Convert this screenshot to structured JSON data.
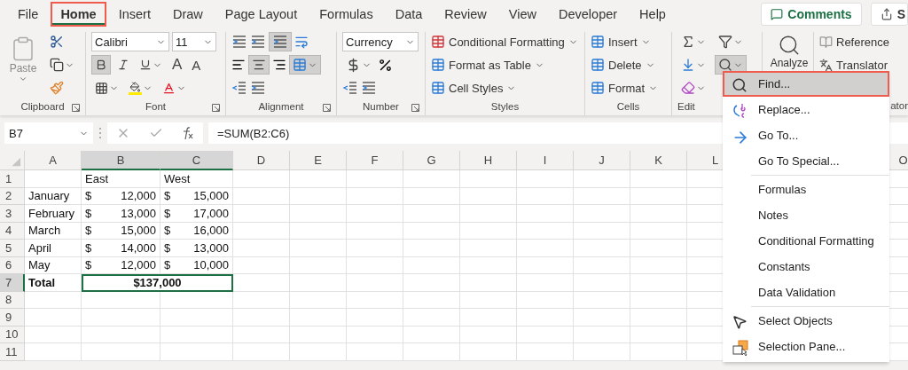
{
  "tabs": [
    {
      "label": "File",
      "selected": false
    },
    {
      "label": "Home",
      "selected": true
    },
    {
      "label": "Insert",
      "selected": false
    },
    {
      "label": "Draw",
      "selected": false
    },
    {
      "label": "Page Layout",
      "selected": false
    },
    {
      "label": "Formulas",
      "selected": false
    },
    {
      "label": "Data",
      "selected": false
    },
    {
      "label": "Review",
      "selected": false
    },
    {
      "label": "View",
      "selected": false
    },
    {
      "label": "Developer",
      "selected": false
    },
    {
      "label": "Help",
      "selected": false
    }
  ],
  "comments_button": "Comments",
  "share_button": "S",
  "ribbon": {
    "clipboard": {
      "paste": "Paste",
      "label": "Clipboard"
    },
    "font": {
      "name": "Calibri",
      "size": "11",
      "grow": "A",
      "shrink": "A",
      "label": "Font"
    },
    "alignment": {
      "label": "Alignment"
    },
    "number": {
      "format": "Currency",
      "label": "Number"
    },
    "styles": {
      "items": [
        "Conditional Formatting",
        "Format as Table",
        "Cell Styles"
      ],
      "label": "Styles"
    },
    "cells": {
      "items": [
        "Insert",
        "Delete",
        "Format"
      ],
      "label": "Cells"
    },
    "editing": {
      "label": "Edit"
    },
    "analyze": {
      "label": "Analyze"
    },
    "language": {
      "items": [
        "Reference",
        "Translator"
      ],
      "label": "ator"
    }
  },
  "formula_bar": {
    "name_box": "B7",
    "formula": "=SUM(B2:C6)"
  },
  "sheet": {
    "columns": [
      {
        "label": "A",
        "selected": false
      },
      {
        "label": "B",
        "selected": true
      },
      {
        "label": "C",
        "selected": true
      },
      {
        "label": "D",
        "selected": false
      },
      {
        "label": "E",
        "selected": false
      },
      {
        "label": "F",
        "selected": false
      },
      {
        "label": "G",
        "selected": false
      },
      {
        "label": "H",
        "selected": false
      },
      {
        "label": "I",
        "selected": false
      },
      {
        "label": "J",
        "selected": false
      },
      {
        "label": "K",
        "selected": false
      },
      {
        "label": "L",
        "selected": false
      },
      {
        "label": "O",
        "selected": false
      }
    ],
    "rows": [
      {
        "label": "1",
        "selected": false,
        "cells": [
          {
            "kind": "empty"
          },
          {
            "kind": "text",
            "text": "East"
          },
          {
            "kind": "text",
            "text": "West"
          }
        ]
      },
      {
        "label": "2",
        "selected": false,
        "cells": [
          {
            "kind": "text",
            "text": "January"
          },
          {
            "kind": "currency",
            "symbol": "$",
            "amount": "12,000"
          },
          {
            "kind": "currency",
            "symbol": "$",
            "amount": "15,000"
          }
        ]
      },
      {
        "label": "3",
        "selected": false,
        "cells": [
          {
            "kind": "text",
            "text": "February"
          },
          {
            "kind": "currency",
            "symbol": "$",
            "amount": "13,000"
          },
          {
            "kind": "currency",
            "symbol": "$",
            "amount": "17,000"
          }
        ]
      },
      {
        "label": "4",
        "selected": false,
        "cells": [
          {
            "kind": "text",
            "text": "March"
          },
          {
            "kind": "currency",
            "symbol": "$",
            "amount": "15,000"
          },
          {
            "kind": "currency",
            "symbol": "$",
            "amount": "16,000"
          }
        ]
      },
      {
        "label": "5",
        "selected": false,
        "cells": [
          {
            "kind": "text",
            "text": "April"
          },
          {
            "kind": "currency",
            "symbol": "$",
            "amount": "14,000"
          },
          {
            "kind": "currency",
            "symbol": "$",
            "amount": "13,000"
          }
        ]
      },
      {
        "label": "6",
        "selected": false,
        "cells": [
          {
            "kind": "text",
            "text": "May"
          },
          {
            "kind": "currency",
            "symbol": "$",
            "amount": "12,000"
          },
          {
            "kind": "currency",
            "symbol": "$",
            "amount": "10,000"
          }
        ]
      },
      {
        "label": "7",
        "selected": true,
        "cells": [
          {
            "kind": "bold",
            "text": "Total"
          },
          {
            "kind": "merged",
            "text": "$137,000"
          }
        ]
      },
      {
        "label": "8",
        "selected": false
      },
      {
        "label": "9",
        "selected": false
      },
      {
        "label": "10",
        "selected": false
      },
      {
        "label": "11",
        "selected": false
      }
    ]
  },
  "find_menu": {
    "groups": [
      [
        {
          "label": "Find...",
          "selected": true
        },
        {
          "label": "Replace...",
          "selected": false
        },
        {
          "label": "Go To...",
          "selected": false
        },
        {
          "label": "Go To Special...",
          "selected": false
        }
      ],
      [
        {
          "label": "Formulas",
          "selected": false
        },
        {
          "label": "Notes",
          "selected": false
        },
        {
          "label": "Conditional Formatting",
          "selected": false
        },
        {
          "label": "Constants",
          "selected": false
        },
        {
          "label": "Data Validation",
          "selected": false
        }
      ],
      [
        {
          "label": "Select Objects",
          "selected": false
        },
        {
          "label": "Selection Pane...",
          "selected": false
        }
      ]
    ]
  }
}
